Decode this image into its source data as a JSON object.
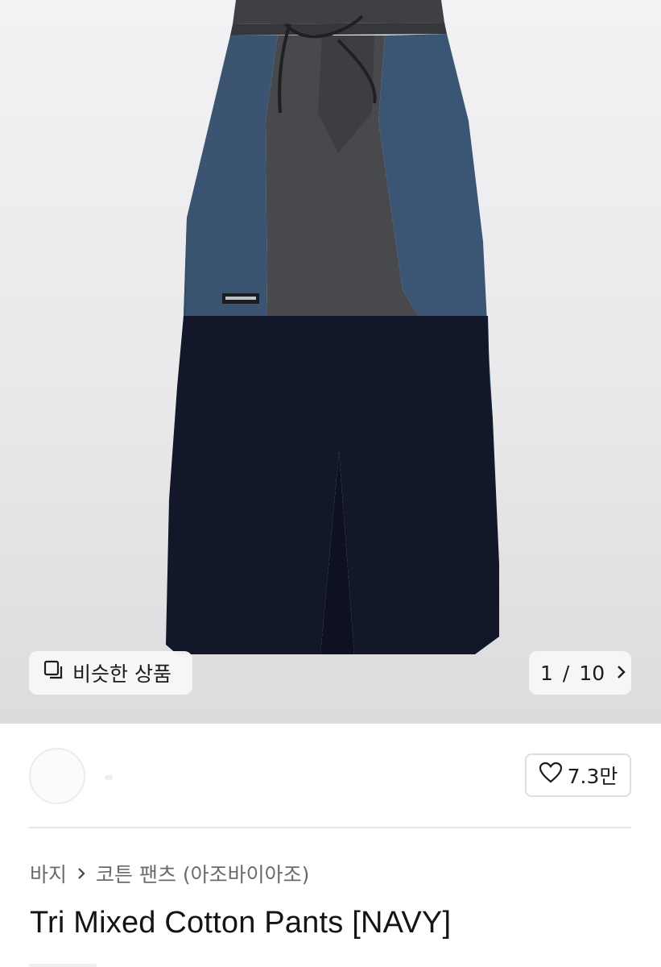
{
  "gallery": {
    "similar_label": "비슷한 상품",
    "current_index": "1",
    "separator": "/",
    "total_count": "10",
    "product_image_alt": "product-photo-pants"
  },
  "seller": {
    "likes_label": "7.3만"
  },
  "product": {
    "category": "바지",
    "subcategory": "코튼 팬츠 (아조바이아조)",
    "title": "Tri Mixed Cotton Pants [NAVY]"
  },
  "icons": {
    "similar": "copy-squares-icon",
    "next": "chevron-right-icon",
    "like": "heart-outline-icon",
    "breadcrumb_sep": "chevron-right-icon"
  },
  "colors": {
    "navy_blue_panel": "#3a5472",
    "charcoal_panel": "#47494c",
    "dark_navy_panel": "#12172a"
  }
}
